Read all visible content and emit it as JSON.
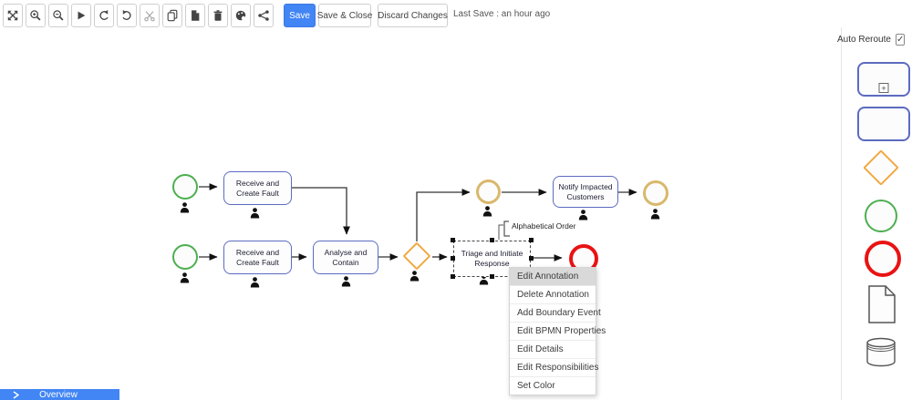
{
  "toolbar": {
    "icon_buttons": [
      {
        "name": "fit-screen"
      },
      {
        "name": "zoom-in"
      },
      {
        "name": "zoom-out"
      },
      {
        "name": "play"
      },
      {
        "name": "undo"
      },
      {
        "name": "redo"
      },
      {
        "name": "cut"
      },
      {
        "name": "copy"
      },
      {
        "name": "paste"
      },
      {
        "name": "delete"
      },
      {
        "name": "color-palette"
      },
      {
        "name": "share"
      }
    ],
    "save_label": "Save",
    "save_close_label": "Save & Close",
    "discard_label": "Discard Changes",
    "last_save": "Last Save : an hour ago"
  },
  "sidebar": {
    "auto_reroute_label": "Auto Reroute",
    "auto_reroute_checked": true,
    "check_glyph": "✓",
    "subprocess_marker": "+",
    "palette": [
      {
        "name": "subprocess"
      },
      {
        "name": "task"
      },
      {
        "name": "gateway"
      },
      {
        "name": "start-event"
      },
      {
        "name": "end-event"
      },
      {
        "name": "document"
      },
      {
        "name": "data-store"
      }
    ]
  },
  "canvas": {
    "nodes": {
      "task_receive_top": {
        "label": "Receive and Create Fault"
      },
      "task_receive_bottom": {
        "label": "Receive and Create Fault"
      },
      "task_analyse": {
        "label": "Analyse and Contain"
      },
      "task_notify": {
        "label": "Notify Impacted Customers"
      },
      "task_triage": {
        "label": "Triage and Initiate Response"
      }
    },
    "annotation_label": "Alphabetical Order"
  },
  "context_menu": {
    "items": [
      {
        "label": "Edit Annotation",
        "highlighted": true
      },
      {
        "label": "Delete Annotation",
        "highlighted": false
      },
      {
        "label": "Add Boundary Event",
        "highlighted": false
      },
      {
        "label": "Edit BPMN Properties",
        "highlighted": false
      },
      {
        "label": "Edit Details",
        "highlighted": false
      },
      {
        "label": "Edit Responsibilities",
        "highlighted": false
      },
      {
        "label": "Set Color",
        "highlighted": false
      }
    ]
  },
  "overview": {
    "label": "Overview"
  },
  "colors": {
    "accent_blue": "#4285f4",
    "task_border": "#5c6bc0",
    "start_event_green": "#4caf50",
    "gateway_orange": "#f0a942",
    "intermediate_tan": "#d9b86c",
    "end_event_red": "#e81313",
    "menu_highlight": "#d9d9d9"
  }
}
